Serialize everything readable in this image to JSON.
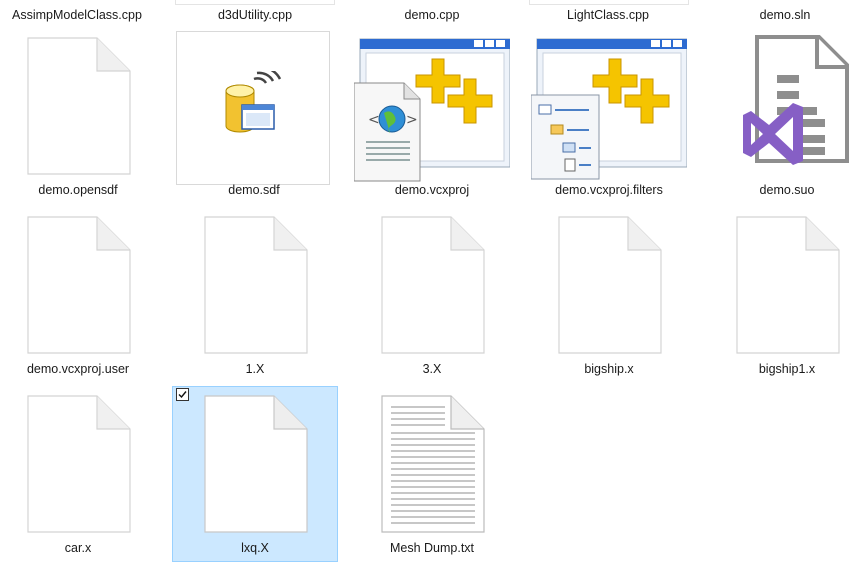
{
  "top_row": [
    {
      "label": "AssimpModelClass.cpp"
    },
    {
      "label": "d3dUtility.cpp"
    },
    {
      "label": "demo.cpp"
    },
    {
      "label": "LightClass.cpp"
    },
    {
      "label": "demo.sln"
    }
  ],
  "files": [
    {
      "name": "demo.opensdf",
      "icon": "blank-document-icon",
      "selected": false
    },
    {
      "name": "demo.sdf",
      "icon": "database-file-icon",
      "selected": false
    },
    {
      "name": "demo.vcxproj",
      "icon": "vcxproj-file-icon",
      "selected": false
    },
    {
      "name": "demo.vcxproj.filters",
      "icon": "vcxproj-filters-file-icon",
      "selected": false
    },
    {
      "name": "demo.suo",
      "icon": "visual-studio-suo-icon",
      "selected": false
    },
    {
      "name": "demo.vcxproj.user",
      "icon": "blank-document-icon",
      "selected": false
    },
    {
      "name": "1.X",
      "icon": "blank-document-icon",
      "selected": false
    },
    {
      "name": "3.X",
      "icon": "blank-document-icon",
      "selected": false
    },
    {
      "name": "bigship.x",
      "icon": "blank-document-icon",
      "selected": false
    },
    {
      "name": "bigship1.x",
      "icon": "blank-document-icon",
      "selected": false
    },
    {
      "name": "car.x",
      "icon": "blank-document-icon",
      "selected": false
    },
    {
      "name": "lxq.X",
      "icon": "blank-document-icon",
      "selected": true
    },
    {
      "name": "Mesh Dump.txt",
      "icon": "text-document-icon",
      "selected": false
    }
  ],
  "colors": {
    "selection_bg": "#cce8ff",
    "selection_border": "#99d1ff",
    "vs_purple": "#865fc5",
    "plus_yellow": "#f5c400"
  }
}
